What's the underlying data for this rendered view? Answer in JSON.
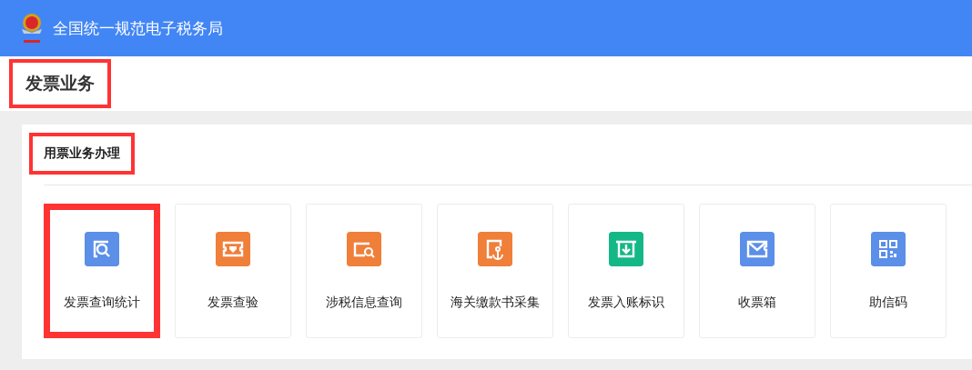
{
  "header": {
    "title": "全国统一规范电子税务局"
  },
  "page_title": {
    "text": "发票业务",
    "highlighted": true
  },
  "section": {
    "title": "用票业务办理",
    "highlighted": true,
    "tiles": [
      {
        "label": "发票查询统计",
        "kind": "search-doc",
        "color": "#5b8fe8",
        "highlighted": true
      },
      {
        "label": "发票查验",
        "kind": "ticket",
        "color": "#f07f3a",
        "highlighted": false
      },
      {
        "label": "涉税信息查询",
        "kind": "folder-search",
        "color": "#f07f3a",
        "highlighted": false
      },
      {
        "label": "海关缴款书采集",
        "kind": "anchor-doc",
        "color": "#f07f3a",
        "highlighted": false
      },
      {
        "label": "发票入账标识",
        "kind": "download-ticket",
        "color": "#14b886",
        "highlighted": false
      },
      {
        "label": "收票箱",
        "kind": "mail",
        "color": "#5b8fe8",
        "highlighted": false
      },
      {
        "label": "助信码",
        "kind": "qr",
        "color": "#5b8fe8",
        "highlighted": false
      }
    ]
  }
}
